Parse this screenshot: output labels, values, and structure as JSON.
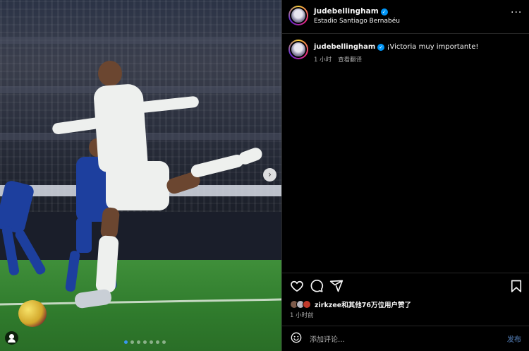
{
  "post": {
    "username": "judebellingham",
    "location": "Estadio Santiago Bernabéu",
    "caption": "¡Victoria muy importante!",
    "caption_time": "1 小时",
    "see_translation": "查看翻译",
    "likes_user": "zirkzee",
    "likes_rest": "和其他76万位用户赞了",
    "time_ago": "1 小时前",
    "comment_placeholder": "添加评论…",
    "post_button": "发布",
    "more_menu": "···"
  },
  "carousel": {
    "total": 7,
    "active_index": 0
  },
  "colors": {
    "verified": "#0095f6",
    "post_button_disabled": "#3d5d87",
    "active_dot": "#3897f0"
  },
  "icons": [
    "verified-badge-icon",
    "more-options-icon",
    "heart-icon",
    "comment-icon",
    "share-icon",
    "bookmark-icon",
    "emoji-icon",
    "next-arrow-icon",
    "tag-user-icon"
  ]
}
